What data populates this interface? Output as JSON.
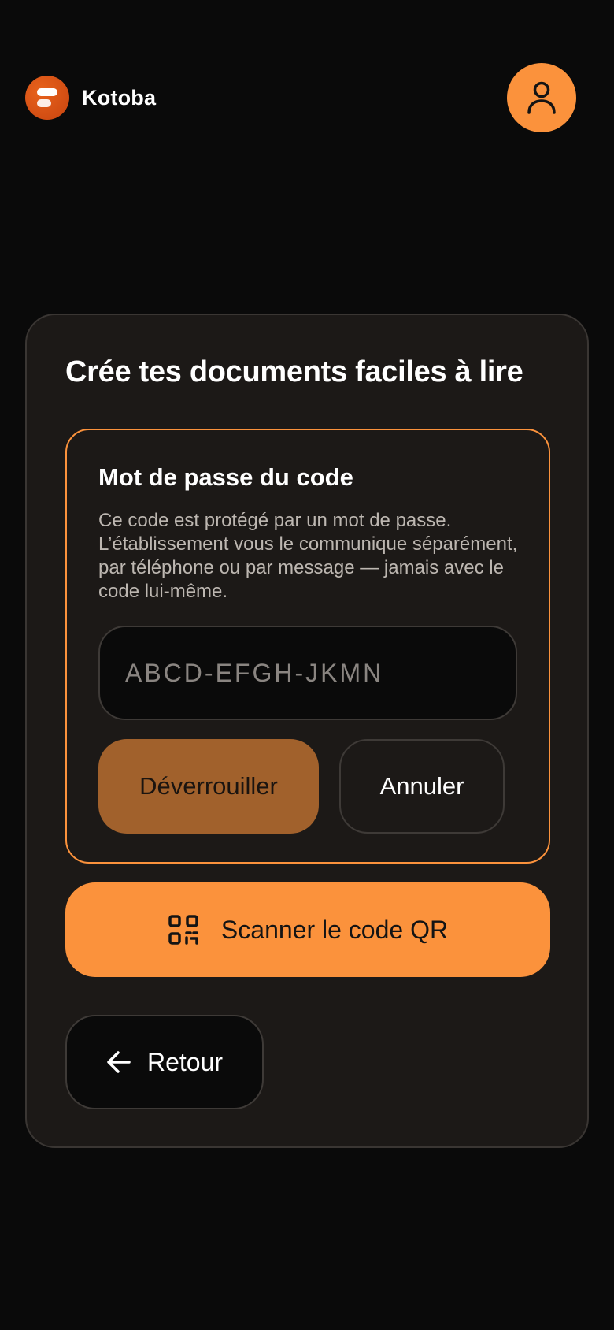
{
  "header": {
    "brand_name": "Kotoba",
    "logo_icon": "kotoba-logo",
    "profile_icon": "user-icon"
  },
  "colors": {
    "accent": "#fb923c",
    "accent_muted": "#a1612c",
    "background": "#0a0a0a",
    "card": "#1c1917",
    "logo": "#d4511a"
  },
  "card": {
    "title": "Crée tes documents faciles à lire"
  },
  "password_panel": {
    "title": "Mot de passe du code",
    "description": "Ce code est protégé par un mot de passe. L’établissement vous le communique séparément, par téléphone ou par message — jamais avec le code lui-même.",
    "input_placeholder": "ABCD-EFGH-JKMN",
    "input_value": "",
    "unlock_label": "Déverrouiller",
    "cancel_label": "Annuler"
  },
  "scan": {
    "label": "Scanner le code QR",
    "icon": "qr-code-icon"
  },
  "back": {
    "label": "Retour",
    "icon": "arrow-left-icon"
  }
}
